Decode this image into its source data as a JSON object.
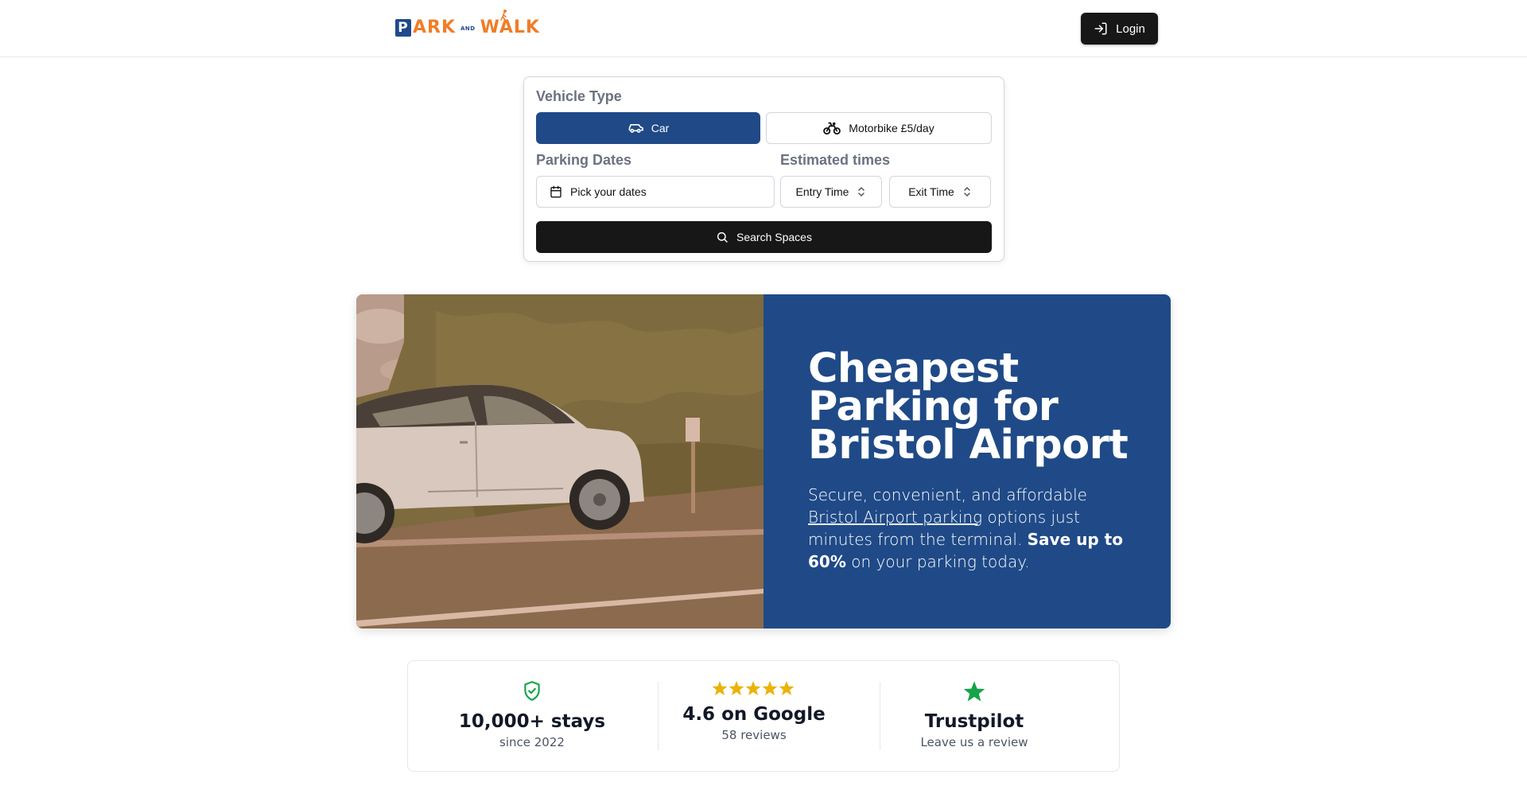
{
  "header": {
    "logo": {
      "p": "P",
      "ark": "ARK",
      "and": "AND",
      "walk": "WALK"
    },
    "login_label": "Login"
  },
  "search": {
    "vehicle_type_label": "Vehicle Type",
    "car_label": "Car",
    "motorbike_label": "Motorbike £5/day",
    "parking_dates_label": "Parking Dates",
    "estimated_times_label": "Estimated times",
    "dates_placeholder": "Pick your dates",
    "entry_time_label": "Entry Time",
    "exit_time_label": "Exit Time",
    "search_button_label": "Search Spaces"
  },
  "hero": {
    "title": "Cheapest Parking for Bristol Airport",
    "text_before": "Secure, convenient, and affordable ",
    "link_text": "Bristol Airport parking",
    "text_middle": " options just minutes from the terminal. ",
    "bold_text": "Save up to 60%",
    "text_after": " on your parking today."
  },
  "stats": [
    {
      "icon": "shield-check-icon",
      "title": "10,000+ stays",
      "subtitle": "since 2022"
    },
    {
      "icon": "five-stars-icon",
      "stars": 5,
      "title": "4.6 on Google",
      "subtitle": "58 reviews"
    },
    {
      "icon": "star-icon",
      "title": "Trustpilot",
      "subtitle": "Leave us a review"
    }
  ],
  "colors": {
    "brand_blue": "#1f4a87",
    "brand_orange": "#f07d28",
    "dark_button": "#171717",
    "star_yellow": "#eab308",
    "trustpilot_green": "#16a34a"
  }
}
